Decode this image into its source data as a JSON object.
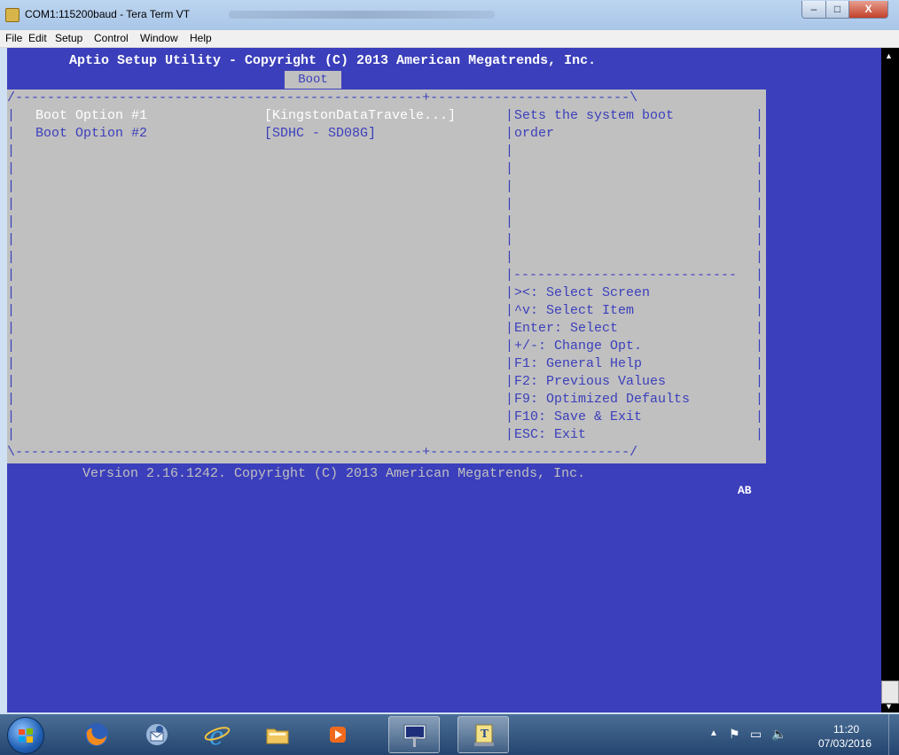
{
  "window": {
    "title": "COM1:115200baud - Tera Term VT",
    "minimize_glyph": "–",
    "maximize_glyph": "□",
    "close_glyph": "X"
  },
  "menu": [
    "File",
    "Edit",
    "Setup",
    "Control",
    "Window",
    "Help"
  ],
  "bios": {
    "header": "Aptio Setup Utility - Copyright (C) 2013 American Megatrends, Inc.",
    "active_tab": "Boot",
    "border_top": "/---------------------------------------------------+-------------------------\\",
    "border_mid": "|----------------------------",
    "border_bottom": "\\---------------------------------------------------+-------------------------/",
    "boot_options": [
      {
        "label": "Boot Option #1",
        "value": "[KingstonDataTravele...]"
      },
      {
        "label": "Boot Option #2",
        "value": "[SDHC - SD08G]"
      }
    ],
    "help_text": [
      "Sets the system boot",
      "order"
    ],
    "key_help": [
      "><: Select Screen",
      "^v: Select Item",
      "Enter: Select",
      "+/-: Change Opt.",
      "F1: General Help",
      "F2: Previous Values",
      "F9: Optimized Defaults",
      "F10: Save & Exit",
      "ESC: Exit"
    ],
    "footer": "Version 2.16.1242. Copyright (C) 2013 American Megatrends, Inc.",
    "badge": "AB"
  },
  "taskbar": {
    "apps": [
      "start-orb",
      "firefox",
      "thunderbird",
      "internet-explorer",
      "file-explorer",
      "media-player",
      "tera-term",
      "terminal-tool"
    ],
    "clock_time": "11:20",
    "clock_date": "07/03/2016"
  },
  "colors": {
    "terminal_bg": "#3b3fbb",
    "panel_bg": "#c0c0c0",
    "highlight_text": "#ffffff"
  }
}
